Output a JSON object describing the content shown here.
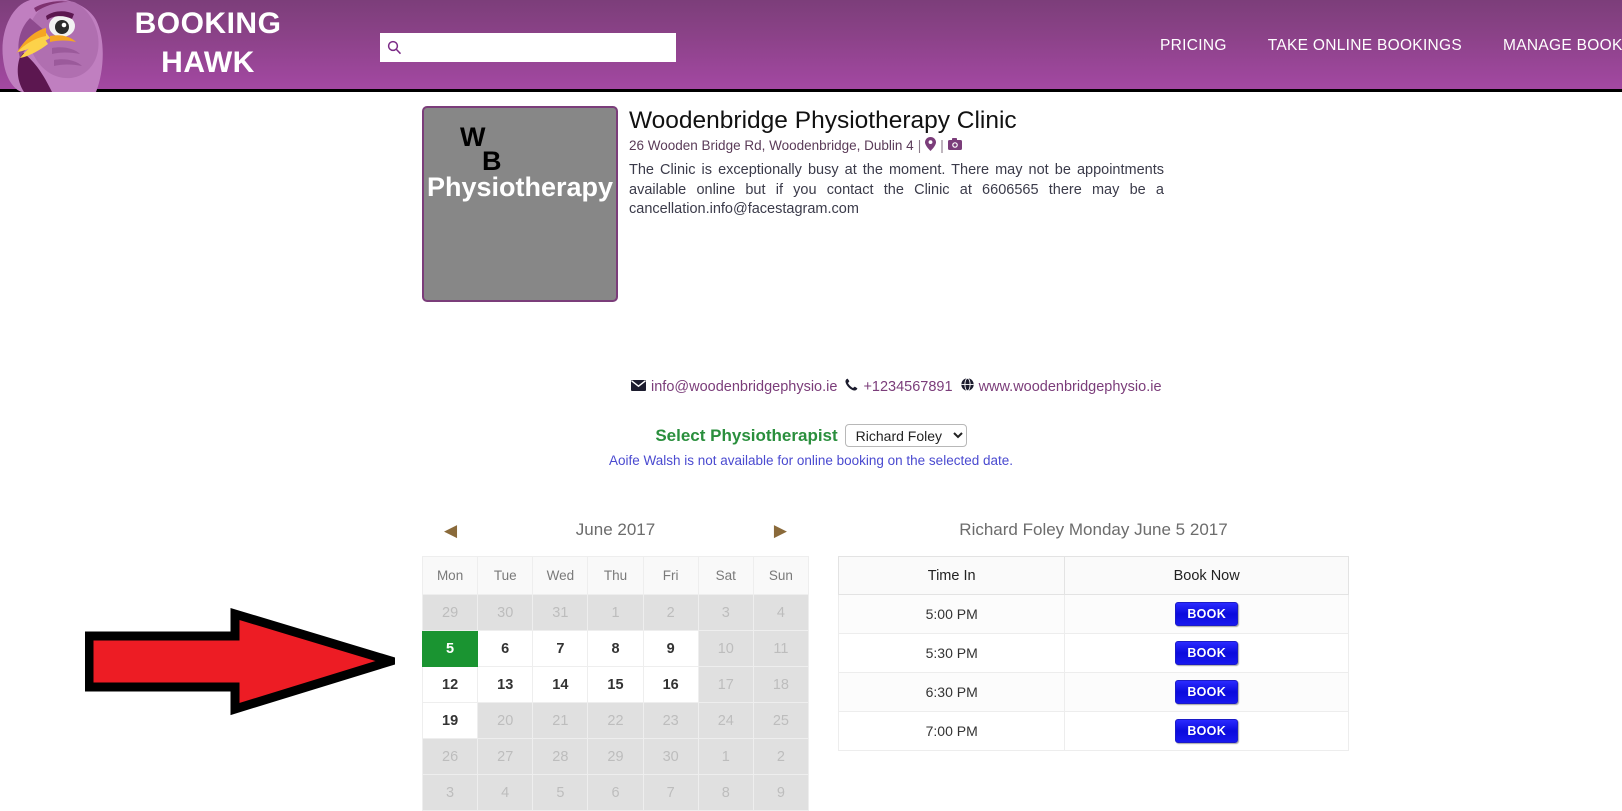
{
  "header": {
    "brand_line1": "BOOKING",
    "brand_line2": "HAWK",
    "logo_icon": "hawk-logo-icon",
    "search": {
      "icon": "search-icon",
      "value": "",
      "placeholder": ""
    },
    "nav_items": [
      {
        "label": "PRICING"
      },
      {
        "label": "TAKE ONLINE BOOKINGS"
      },
      {
        "label": "MANAGE BOOKI"
      }
    ],
    "bg_gradient_top": "#7c3e7a",
    "bg_gradient_bottom": "#a348a2"
  },
  "clinic": {
    "logo": {
      "letter_w": "W",
      "letter_b": "B",
      "word": "Physiotherapy",
      "bg_color": "#878787",
      "border_color": "#7b3d7a"
    },
    "name": "Woodenbridge Physiotherapy Clinic",
    "address": "26 Wooden Bridge Rd, Woodenbridge, Dublin 4",
    "address_sep": "|",
    "map_icon": "map-pin-icon",
    "photo_icon": "camera-icon",
    "description": "The Clinic is exceptionally busy at the moment. There may not be appointments available online but if you contact the Clinic at 6606565 there may be a cancellation.info@facestagram.com",
    "contacts": {
      "email_icon": "envelope-icon",
      "email": "info@woodenbridgephysio.ie",
      "phone_icon": "phone-icon",
      "phone": "+1234567891",
      "web_icon": "globe-icon",
      "website": "www.woodenbridgephysio.ie",
      "link_color": "#7b3d7a"
    }
  },
  "selector": {
    "label": "Select Physiotherapist",
    "label_color": "#2a8f3d",
    "selected": "Richard Foley",
    "options": [
      "Richard Foley",
      "Aoife Walsh"
    ],
    "dropdown_icon": "chevron-down-icon"
  },
  "notice": {
    "text": "Aoife Walsh is not available for online booking on the selected date.",
    "color": "#4a4ad0"
  },
  "calendar": {
    "prev_icon": "triangle-left-icon",
    "next_icon": "triangle-right-icon",
    "month": "June",
    "year": "2017",
    "title": "June  2017",
    "weekdays": [
      "Mon",
      "Tue",
      "Wed",
      "Thu",
      "Fri",
      "Sat",
      "Sun"
    ],
    "selected_day": "5",
    "selected_color": "#1a9431",
    "weeks": [
      [
        {
          "d": "29",
          "state": "dim"
        },
        {
          "d": "30",
          "state": "dim"
        },
        {
          "d": "31",
          "state": "dim"
        },
        {
          "d": "1",
          "state": "dim"
        },
        {
          "d": "2",
          "state": "dim"
        },
        {
          "d": "3",
          "state": "dim"
        },
        {
          "d": "4",
          "state": "dim"
        }
      ],
      [
        {
          "d": "5",
          "state": "sel"
        },
        {
          "d": "6",
          "state": "on"
        },
        {
          "d": "7",
          "state": "on"
        },
        {
          "d": "8",
          "state": "on"
        },
        {
          "d": "9",
          "state": "on"
        },
        {
          "d": "10",
          "state": "dim"
        },
        {
          "d": "11",
          "state": "dim"
        }
      ],
      [
        {
          "d": "12",
          "state": "on"
        },
        {
          "d": "13",
          "state": "on"
        },
        {
          "d": "14",
          "state": "on"
        },
        {
          "d": "15",
          "state": "on"
        },
        {
          "d": "16",
          "state": "on"
        },
        {
          "d": "17",
          "state": "dim"
        },
        {
          "d": "18",
          "state": "dim"
        }
      ],
      [
        {
          "d": "19",
          "state": "on"
        },
        {
          "d": "20",
          "state": "dim"
        },
        {
          "d": "21",
          "state": "dim"
        },
        {
          "d": "22",
          "state": "dim"
        },
        {
          "d": "23",
          "state": "dim"
        },
        {
          "d": "24",
          "state": "dim"
        },
        {
          "d": "25",
          "state": "dim"
        }
      ],
      [
        {
          "d": "26",
          "state": "dim"
        },
        {
          "d": "27",
          "state": "dim"
        },
        {
          "d": "28",
          "state": "dim"
        },
        {
          "d": "29",
          "state": "dim"
        },
        {
          "d": "30",
          "state": "dim"
        },
        {
          "d": "1",
          "state": "dim"
        },
        {
          "d": "2",
          "state": "dim"
        }
      ],
      [
        {
          "d": "3",
          "state": "dim"
        },
        {
          "d": "4",
          "state": "dim"
        },
        {
          "d": "5",
          "state": "dim"
        },
        {
          "d": "6",
          "state": "dim"
        },
        {
          "d": "7",
          "state": "dim"
        },
        {
          "d": "8",
          "state": "dim"
        },
        {
          "d": "9",
          "state": "dim"
        }
      ]
    ]
  },
  "slots": {
    "title": "Richard Foley Monday June 5 2017",
    "columns": [
      "Time In",
      "Book Now"
    ],
    "button_label": "BOOK",
    "button_color": "#1818ee",
    "rows": [
      {
        "time": "5:00 PM",
        "action": "BOOK"
      },
      {
        "time": "5:30 PM",
        "action": "BOOK"
      },
      {
        "time": "6:30 PM",
        "action": "BOOK"
      },
      {
        "time": "7:00 PM",
        "action": "BOOK"
      }
    ]
  },
  "annotation": {
    "shape": "red-arrow-right",
    "fill": "#ed1c24",
    "stroke": "#000000"
  }
}
